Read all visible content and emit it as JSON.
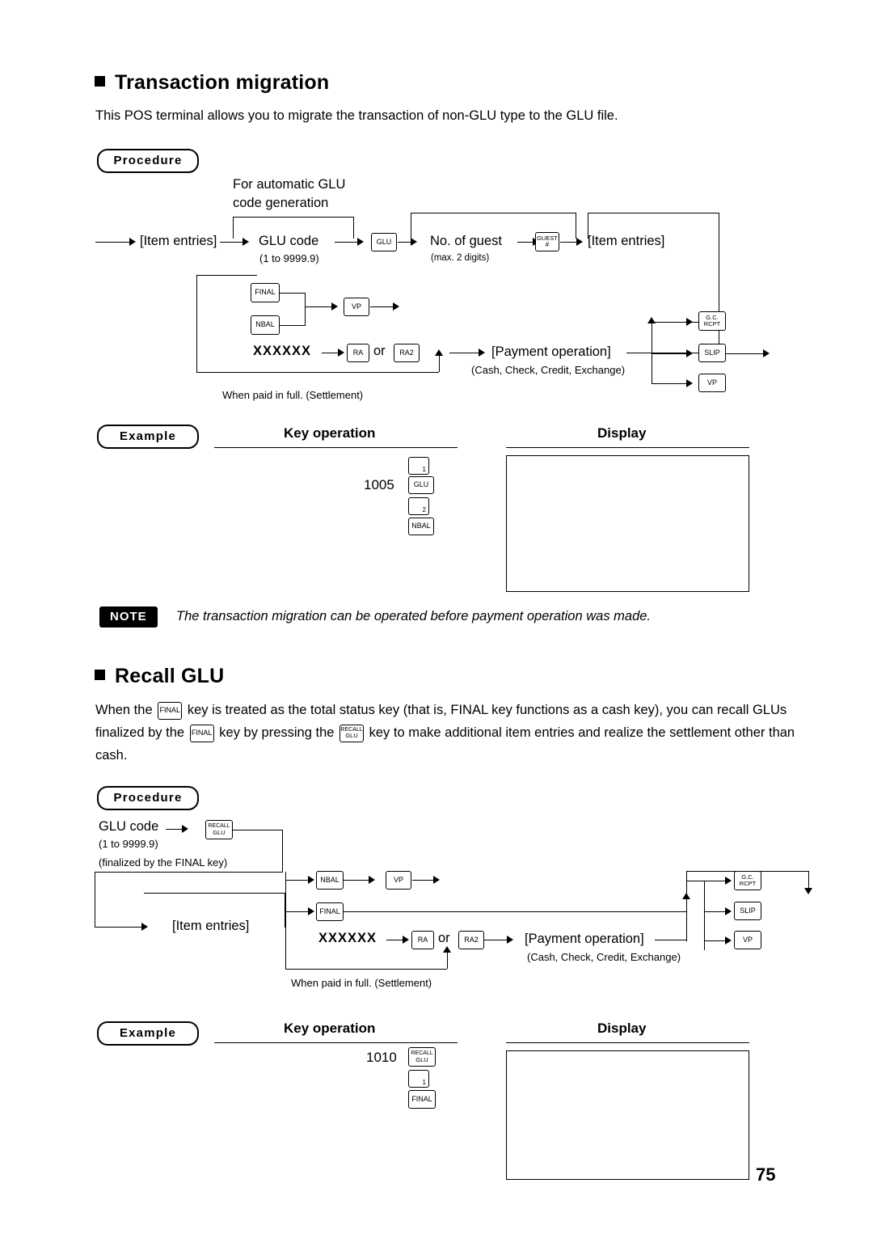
{
  "page": {
    "number": "75"
  },
  "section1": {
    "heading": "Transaction migration",
    "intro": "This POS terminal allows you to migrate the transaction of non-GLU type to the GLU file.",
    "procedure_label": "Procedure",
    "example_label": "Example",
    "col_key_operation": "Key operation",
    "col_display": "Display",
    "flow": {
      "auto_glu_line1": "For automatic GLU",
      "auto_glu_line2": "code generation",
      "item_entries_1": "[Item entries]",
      "glu_code": "GLU code",
      "glu_range": "(1 to 9999.9)",
      "key_glu": "GLU",
      "no_of_guest": "No. of guest",
      "max_digits": "(max. 2 digits)",
      "key_guest_line1": "GUEST",
      "key_guest_line2": "#",
      "item_entries_2": "[Item entries]",
      "key_final": "FINAL",
      "key_nbal": "NBAL",
      "key_vp": "VP",
      "xxxxxx": "XXXXXX",
      "key_ra": "RA",
      "or": "or",
      "key_ra2": "RA2",
      "payment_operation": "[Payment operation]",
      "payment_types": "(Cash, Check, Credit, Exchange)",
      "paid_in_full": "When paid in full. (Settlement)",
      "key_gc_line1": "G.C.",
      "key_gc_line2": "RCPT",
      "key_slip": "SLIP",
      "key_vp2": "VP"
    },
    "example": {
      "amount": "1005",
      "key_glu": "GLU",
      "key_1": "1",
      "key_2": "2",
      "key_nbal": "NBAL"
    }
  },
  "note": {
    "badge": "NOTE",
    "text": "The transaction migration can be operated before payment operation was made."
  },
  "section2": {
    "heading": "Recall GLU",
    "para": {
      "l1a": "When the",
      "k1": "FINAL",
      "l1b": "key is treated as the total status key (that is, FINAL key functions as a cash key), you can",
      "l2a": "recall GLUs finalized by the",
      "k2": "FINAL",
      "l2b": "key by pressing the",
      "k3_line1": "RECALL",
      "k3_line2": "GLU",
      "l2c": "key to make additional item entries and realize the",
      "l3": "settlement other than cash."
    },
    "procedure_label": "Procedure",
    "example_label": "Example",
    "col_key_operation": "Key operation",
    "col_display": "Display",
    "flow": {
      "glu_code": "GLU code",
      "glu_range": "(1 to 9999.9)",
      "finalized_by": "(finalized by the FINAL key)",
      "key_recall_line1": "RECALL",
      "key_recall_line2": "GLU",
      "item_entries": "[Item entries]",
      "key_nbal": "NBAL",
      "key_vp": "VP",
      "key_final": "FINAL",
      "xxxxxx": "XXXXXX",
      "key_ra": "RA",
      "or": "or",
      "key_ra2": "RA2",
      "payment_operation": "[Payment operation]",
      "payment_types": "(Cash, Check, Credit, Exchange)",
      "paid_in_full": "When paid in full. (Settlement)",
      "key_gc_line1": "G.C.",
      "key_gc_line2": "RCPT",
      "key_slip": "SLIP",
      "key_vp2": "VP"
    },
    "example": {
      "amount": "1010",
      "key_recall_line1": "RECALL",
      "key_recall_line2": "GLU",
      "key_1": "1",
      "key_final": "FINAL"
    }
  }
}
